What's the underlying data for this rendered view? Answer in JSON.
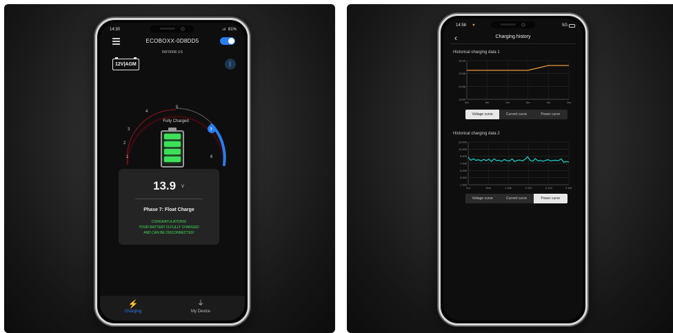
{
  "left_phone": {
    "status": {
      "time": "14:30",
      "signal": ".ııl",
      "battery": "81%"
    },
    "header": {
      "device_name": "ECOBOXX-0D8DD5",
      "sub_label": "INF0008 US"
    },
    "battery_type": "12V|AGM",
    "gauge": {
      "status_label": "Fully Charged",
      "scale_labels": [
        "1",
        "2",
        "3",
        "4",
        "5",
        "6"
      ],
      "top_label": "5",
      "active_phase": "7",
      "arc_track_color": "#6b0f15",
      "arc_active_color": "#2a7ef2"
    },
    "charge_level_fraction": 1.0,
    "card": {
      "voltage": "13.9",
      "unit": "V",
      "phase": "Phase 7: Float Charge",
      "message_line1": "CONGRATULATIONS!",
      "message_line2": "YOUR BATTERY IS FULLY CHARGED",
      "message_line3": "AND CAN BE DISCONNECTED!"
    },
    "nav": {
      "charging_label": "Charging",
      "device_label": "My Device",
      "charging_icon": "lightning-icon",
      "device_icon": "plug-icon",
      "active_color": "#2a7ef2"
    }
  },
  "right_phone": {
    "status": {
      "time": "14:58",
      "network": "5G"
    },
    "header": {
      "title": "Charging history"
    },
    "chart1": {
      "title": "Historical charging data 1",
      "y_ticks": [
        "13.90",
        "13.88",
        "13.86",
        "13.84"
      ],
      "x_ticks": [
        "0m",
        "0m",
        "0m",
        "0m",
        "0m",
        "0m"
      ],
      "tabs": [
        "Voltage curve",
        "Current curve",
        "Power curve"
      ],
      "active_tab": 0,
      "line_color": "#e89a3c"
    },
    "chart2": {
      "title": "Historical charging data 2",
      "y_ticks": [
        "13.000",
        "11.000",
        "9.000",
        "7.000",
        "5.000",
        "3.000",
        "1.000"
      ],
      "x_ticks": [
        "0m",
        "30m",
        "1.03h",
        "1.37h",
        "2.10h",
        "2.45h"
      ],
      "tabs": [
        "Voltage curve",
        "Current curve",
        "Power curve"
      ],
      "active_tab": 2,
      "line_color": "#1fc9c2"
    }
  },
  "chart_data": [
    {
      "type": "line",
      "title": "Historical charging data 1",
      "x": [
        "0m",
        "0m",
        "0m",
        "0m",
        "0m",
        "0m"
      ],
      "series": [
        {
          "values": [
            13.89,
            13.89,
            13.89,
            13.89,
            13.9,
            13.9
          ]
        }
      ],
      "ylim": [
        13.83,
        13.91
      ]
    },
    {
      "type": "line",
      "title": "Historical charging data 2",
      "x": [
        "0m",
        "30m",
        "1.03h",
        "1.37h",
        "2.10h",
        "2.45h"
      ],
      "series": [
        {
          "values": [
            9,
            8,
            8.5,
            8,
            8.2,
            7.8,
            8.3,
            7.9,
            8.4,
            7.6,
            8.5,
            7.9,
            8,
            7.7,
            8.3,
            7.9,
            7.8,
            8.5,
            7.6,
            8,
            8.1,
            7.8,
            8.3,
            9.2,
            8,
            7.7,
            8.6,
            7.8,
            8,
            7.7,
            8,
            8.2,
            7.8,
            8,
            8,
            7.9,
            8.5,
            7.4,
            7.6,
            7.5
          ]
        }
      ],
      "ylim": [
        0,
        14
      ]
    }
  ]
}
